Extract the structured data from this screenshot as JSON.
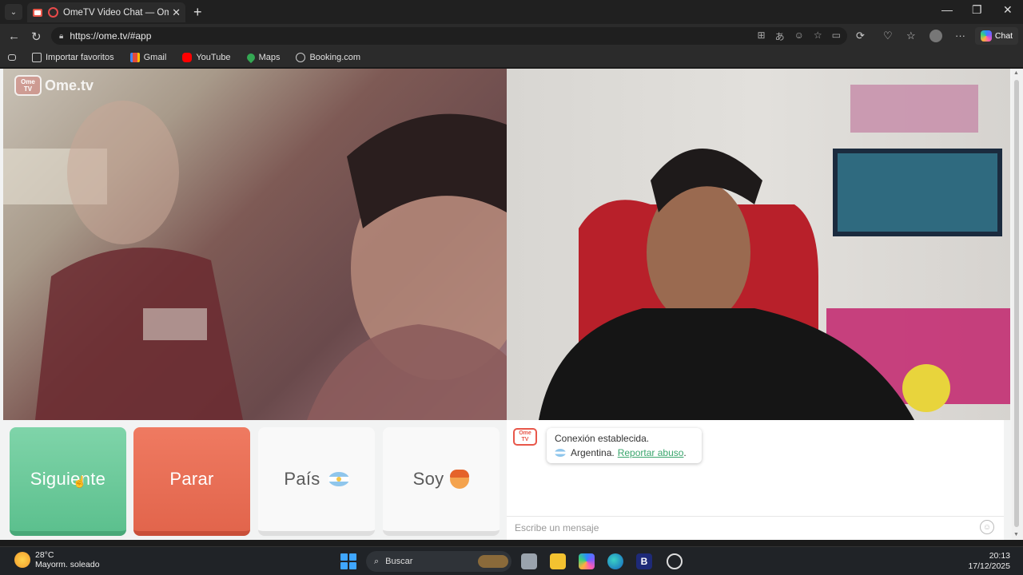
{
  "browser": {
    "tab_title": "OmeTV Video Chat — Omegle",
    "tab_close": "✕",
    "new_tab": "+",
    "url": "https://ome.tv/#app",
    "chat_button": "Chat",
    "window_controls": {
      "minimize": "—",
      "restore": "❐",
      "close": "✕"
    }
  },
  "bookmarks": [
    {
      "label": "Importar favoritos",
      "icon": "import-icon",
      "color": "#cccccc"
    },
    {
      "label": "Gmail",
      "icon": "gmail-icon",
      "color": "#e24b3b"
    },
    {
      "label": "YouTube",
      "icon": "youtube-icon",
      "color": "#ff0000"
    },
    {
      "label": "Maps",
      "icon": "maps-icon",
      "color": "#34a853"
    },
    {
      "label": "Booking.com",
      "icon": "globe-icon",
      "color": "#cccccc"
    }
  ],
  "app": {
    "logo_badge": "Ome TV",
    "logo_text": "Ome.tv",
    "buttons": {
      "next": "Siguiente",
      "stop": "Parar",
      "country": "País",
      "gender": "Soy"
    },
    "colors": {
      "next": "#6fcb9c",
      "stop": "#e96e55",
      "link": "#3aa66d"
    }
  },
  "chat": {
    "logo_badge": "Ome TV",
    "status": "Conexión establecida.",
    "country": "Argentina.",
    "report_link": "Reportar abuso",
    "report_suffix": ".",
    "input_placeholder": "Escribe un mensaje"
  },
  "taskbar": {
    "temperature": "28°C",
    "weather": "Mayorm. soleado",
    "search_label": "Buscar",
    "time": "20:13",
    "date": "17/12/2025"
  }
}
